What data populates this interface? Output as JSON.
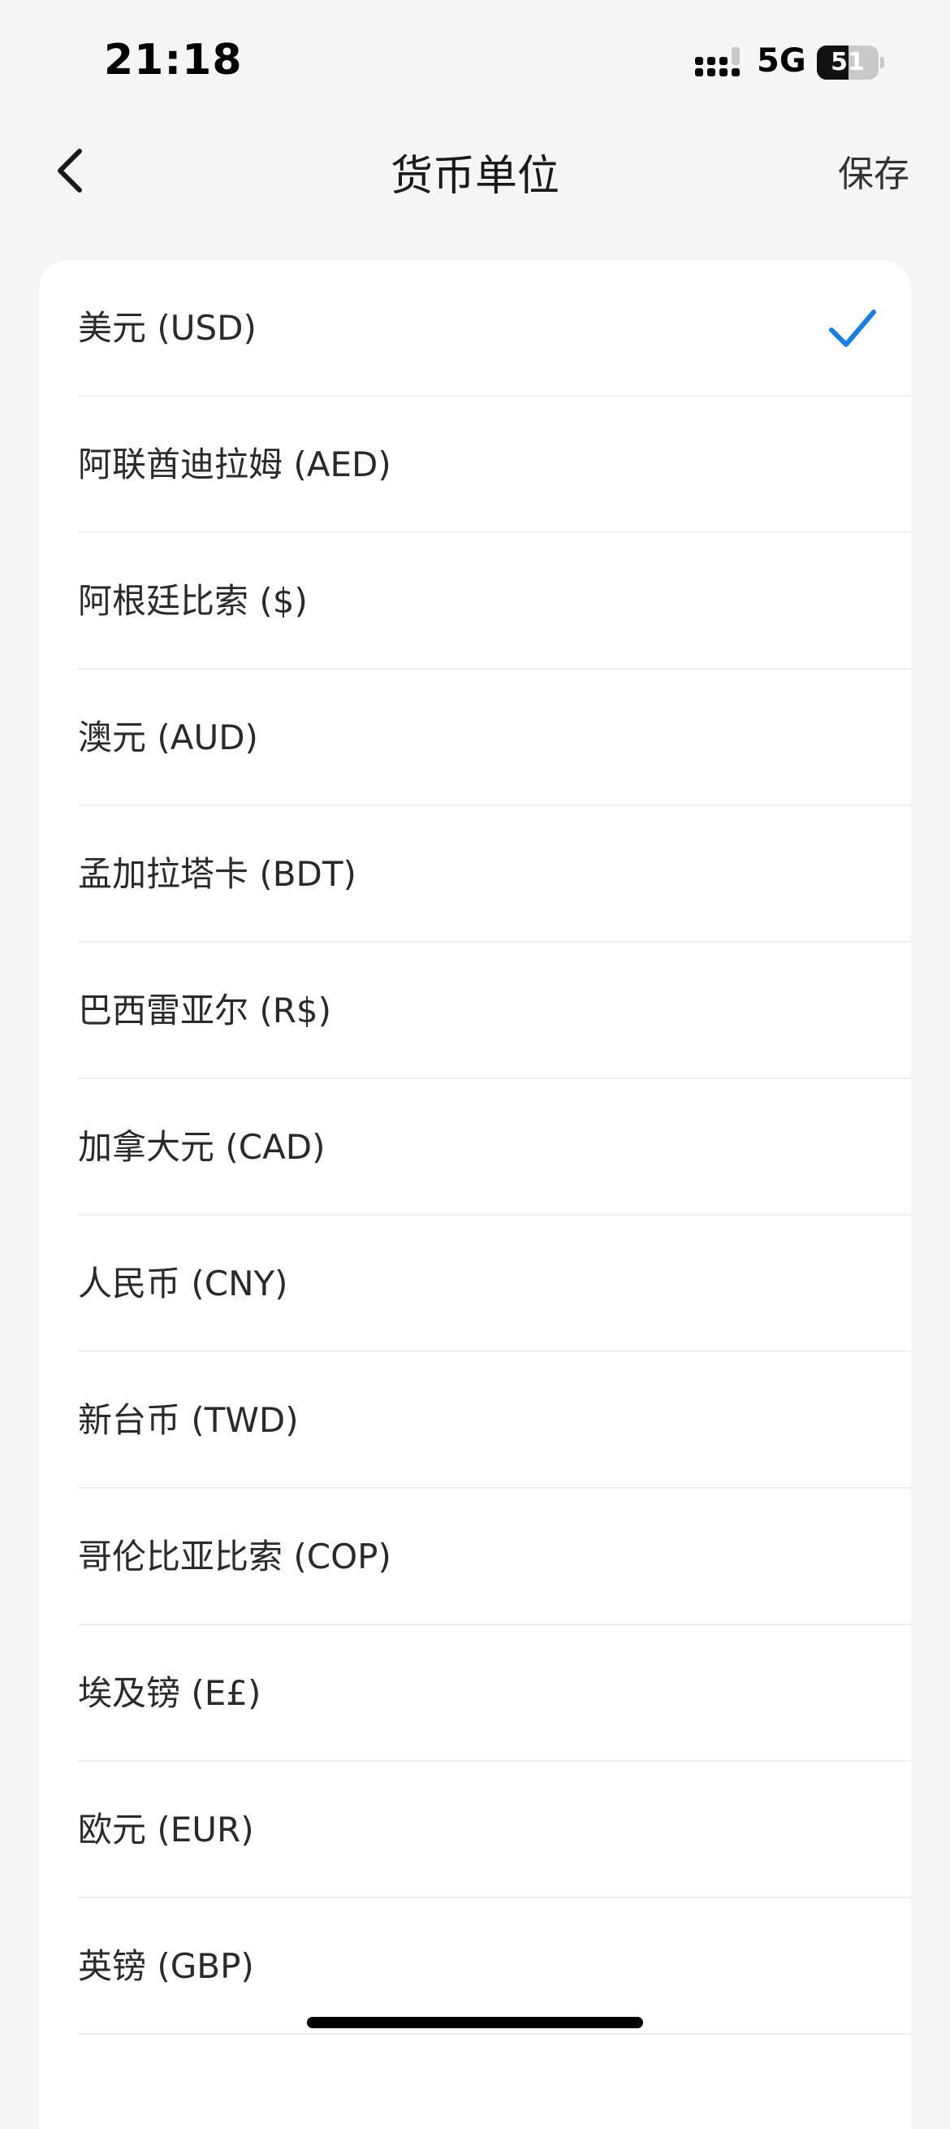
{
  "status_bar": {
    "time": "21:18",
    "network": "5G",
    "battery_level": "51",
    "battery_fraction": 0.51,
    "signal_icon": "signal-icon",
    "battery_icon": "battery-icon"
  },
  "nav": {
    "title": "货币单位",
    "save_label": "保存",
    "back_icon": "chevron-left-icon"
  },
  "accent_color": "#1a7fe0",
  "currencies": [
    {
      "label": "美元 (USD)",
      "selected": true
    },
    {
      "label": "阿联酋迪拉姆 (AED)",
      "selected": false
    },
    {
      "label": "阿根廷比索 ($)",
      "selected": false
    },
    {
      "label": "澳元 (AUD)",
      "selected": false
    },
    {
      "label": "孟加拉塔卡 (BDT)",
      "selected": false
    },
    {
      "label": "巴西雷亚尔 (R$)",
      "selected": false
    },
    {
      "label": "加拿大元 (CAD)",
      "selected": false
    },
    {
      "label": "人民币 (CNY)",
      "selected": false
    },
    {
      "label": "新台币 (TWD)",
      "selected": false
    },
    {
      "label": "哥伦比亚比索 (COP)",
      "selected": false
    },
    {
      "label": "埃及镑 (E£)",
      "selected": false
    },
    {
      "label": "欧元 (EUR)",
      "selected": false
    },
    {
      "label": "英镑 (GBP)",
      "selected": false
    }
  ]
}
